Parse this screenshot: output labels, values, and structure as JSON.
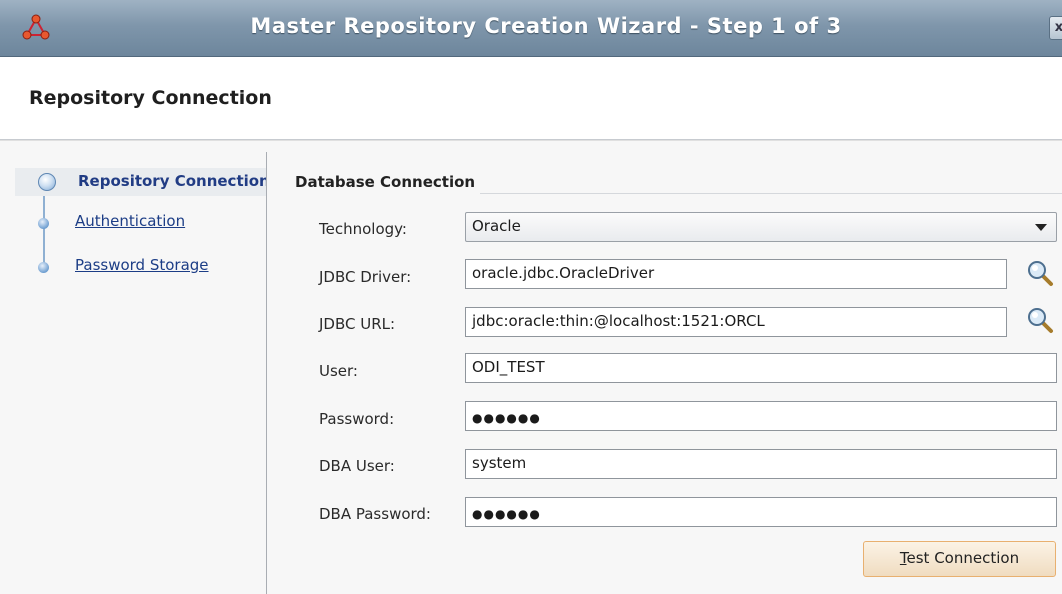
{
  "window": {
    "title": "Master Repository Creation Wizard - Step 1 of 3",
    "close_glyph": "x"
  },
  "header": {
    "title": "Repository Connection"
  },
  "nav": {
    "items": [
      {
        "label": "Repository Connection",
        "state": "active"
      },
      {
        "label": "Authentication",
        "state": "link"
      },
      {
        "label": "Password Storage",
        "state": "link"
      }
    ]
  },
  "form": {
    "section_title": "Database Connection",
    "technology": {
      "label": "Technology:",
      "value": "Oracle"
    },
    "jdbc_driver": {
      "label": "JDBC Driver:",
      "value": "oracle.jdbc.OracleDriver"
    },
    "jdbc_url": {
      "label": "JDBC URL:",
      "value": "jdbc:oracle:thin:@localhost:1521:ORCL"
    },
    "user": {
      "label": "User:",
      "value": "ODI_TEST"
    },
    "password": {
      "label": "Password:",
      "value": "●●●●●●"
    },
    "dba_user": {
      "label": "DBA User:",
      "value": "system"
    },
    "dba_password": {
      "label": "DBA Password:",
      "value": "●●●●●●"
    },
    "test_button": {
      "mnemonic": "T",
      "rest": "est Connection"
    }
  },
  "icons": {
    "app": "network-nodes-icon",
    "lookup": "magnifier-icon",
    "dropdown": "chevron-down-icon"
  },
  "colors": {
    "titlebar": "#7f96ab",
    "link": "#1c3d86",
    "button_border": "#e8b070"
  }
}
